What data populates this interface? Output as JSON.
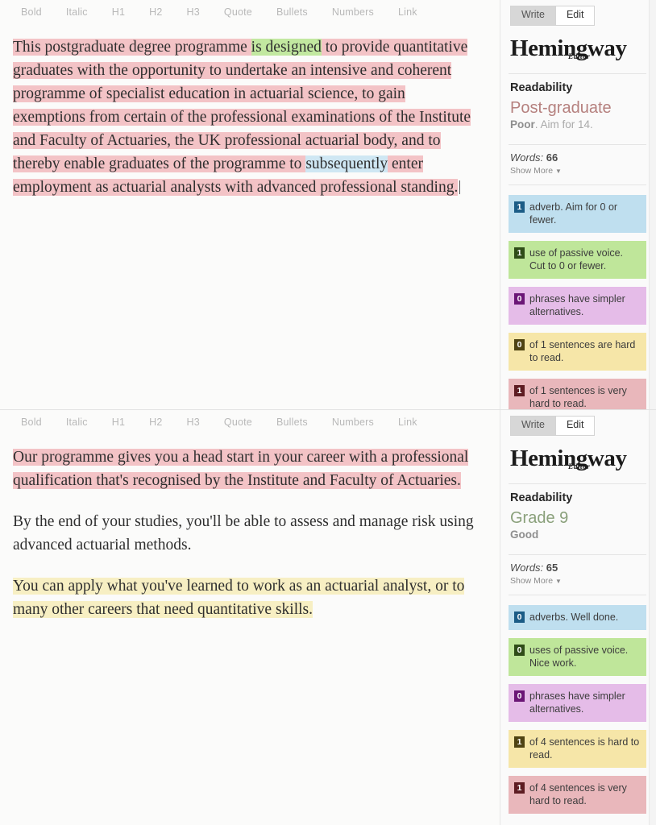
{
  "toolbar": {
    "items": [
      "Bold",
      "Italic",
      "H1",
      "H2",
      "H3",
      "Quote",
      "Bullets",
      "Numbers",
      "Link"
    ]
  },
  "brand": {
    "name": "Hemingway",
    "sub": "Editor"
  },
  "modes": {
    "write": "Write",
    "edit": "Edit"
  },
  "labels": {
    "readability": "Readability",
    "words_key": "Words:",
    "show_more": "Show More",
    "caret_glyph": "▼"
  },
  "colors": {
    "adverb": "#bfdfef",
    "passive": "#bfe69a",
    "simpler": "#e5bce8",
    "hard": "#f6e6a8",
    "very_hard": "#e9b7bb",
    "grade_poor": "#b5807e",
    "grade_good": "#8aa07b"
  },
  "panels": [
    {
      "document": {
        "paragraphs": [
          {
            "segments": [
              {
                "text": " This postgraduate degree programme ",
                "hl": "red"
              },
              {
                "text": "is designed",
                "hl": "green"
              },
              {
                "text": " to provide quantitative graduates with the opportunity to undertake an intensive and coherent programme of specialist education in actuarial science, to gain exemptions from certain of the professional examinations of the Institute and Faculty of Actuaries, the UK professional actuarial body, and to thereby enable graduates of the programme to ",
                "hl": "red"
              },
              {
                "text": "subsequently",
                "hl": "blue"
              },
              {
                "text": " enter employment as actuarial analysts with advanced professional standing.",
                "hl": "red"
              },
              {
                "text": "",
                "hl": "caret"
              }
            ]
          }
        ]
      },
      "readability": {
        "grade": "Post-graduate",
        "grade_class": "poor",
        "verdict": "Poor",
        "advice": ". Aim for 14."
      },
      "words": "66",
      "cards": [
        {
          "color": "blue",
          "count": "1",
          "text": "adverb. Aim for 0 or fewer."
        },
        {
          "color": "green",
          "count": "1",
          "text": "use of passive voice. Cut to 0 or fewer."
        },
        {
          "color": "purple",
          "count": "0",
          "text": "phrases have simpler alternatives."
        },
        {
          "color": "yellow",
          "count": "0",
          "text": "of 1 sentences are hard to read."
        },
        {
          "color": "pink",
          "count": "1",
          "text": "of 1 sentences is very hard to read."
        }
      ]
    },
    {
      "document": {
        "paragraphs": [
          {
            "segments": [
              {
                "text": "Our programme gives you a head start in your career with a professional qualification that's recognised by the Institute and Faculty of Actuaries.",
                "hl": "red"
              }
            ]
          },
          {
            "segments": [
              {
                "text": "By the end of your studies, you'll be able to assess and manage risk using advanced actuarial methods.",
                "hl": "none"
              }
            ]
          },
          {
            "segments": [
              {
                "text": "You can apply what you've learned to work as an actuarial analyst, or to many other careers that need quantitative skills.",
                "hl": "yellow"
              }
            ]
          }
        ]
      },
      "readability": {
        "grade": "Grade 9",
        "grade_class": "good",
        "verdict": "Good",
        "advice": ""
      },
      "words": "65",
      "cards": [
        {
          "color": "blue",
          "count": "0",
          "text": "adverbs. Well done."
        },
        {
          "color": "green",
          "count": "0",
          "text": "uses of passive voice. Nice work."
        },
        {
          "color": "purple",
          "count": "0",
          "text": "phrases have simpler alternatives."
        },
        {
          "color": "yellow",
          "count": "1",
          "text": "of 4 sentences is hard to read."
        },
        {
          "color": "pink",
          "count": "1",
          "text": "of 4 sentences is very hard to read."
        }
      ]
    }
  ]
}
